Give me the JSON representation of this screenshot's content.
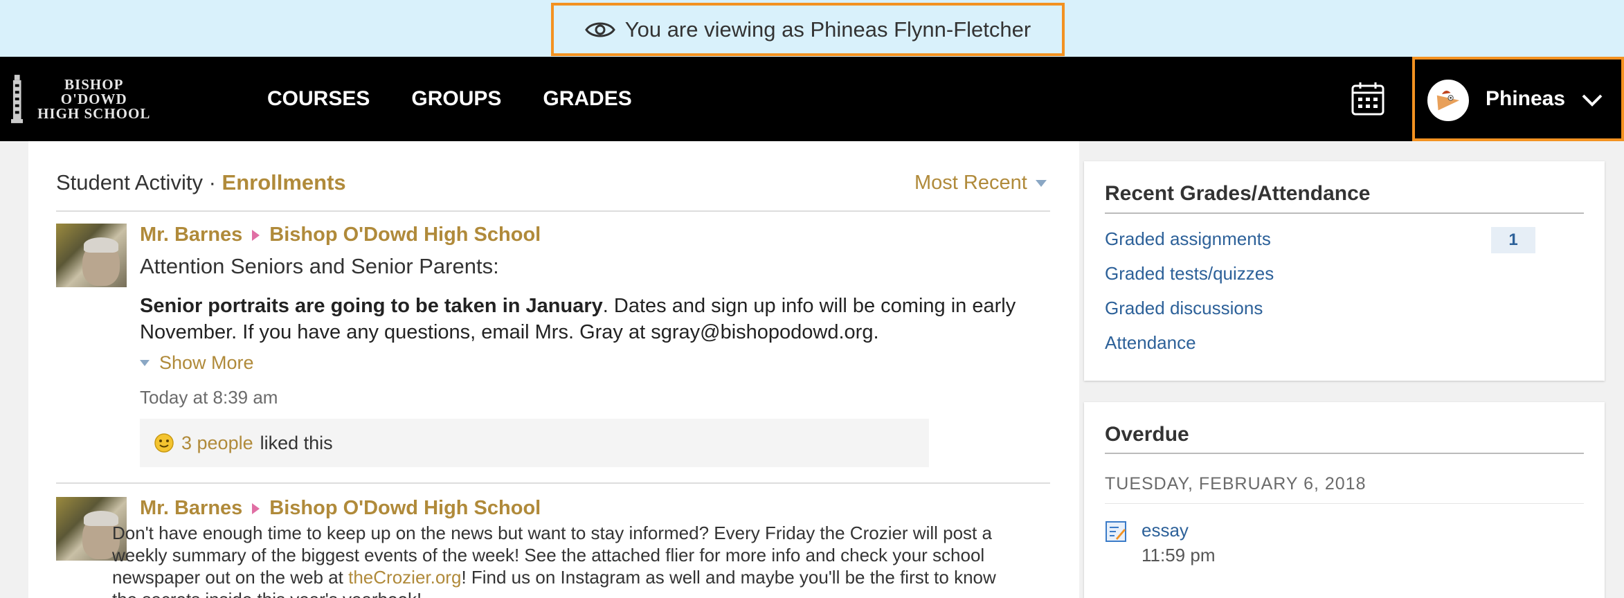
{
  "masquerade": {
    "text": "You are viewing as Phineas Flynn-Fletcher"
  },
  "header": {
    "logo_line1": "BISHOP O'DOWD",
    "logo_line2": "HIGH SCHOOL",
    "nav": [
      "COURSES",
      "GROUPS",
      "GRADES"
    ],
    "user_name": "Phineas",
    "accent_color": "#f39221"
  },
  "activity": {
    "title": "Student Activity",
    "separator": "·",
    "tab_link": "Enrollments",
    "sort_label": "Most Recent",
    "posts": [
      {
        "author": "Mr. Barnes",
        "target": "Bishop O'Dowd High School",
        "lead": "Attention Seniors and Senior Parents:",
        "bold_text": "Senior portraits are going to be taken in January",
        "body_rest": ". Dates and sign up info will be coming in early November. If you have any questions, email Mrs. Gray at sgray@bishopodowd.org.",
        "show_more": "Show More",
        "timestamp": "Today at 8:39 am",
        "likes_count": "3 people",
        "likes_suffix": "liked this"
      },
      {
        "author": "Mr. Barnes",
        "target": "Bishop O'Dowd High School",
        "body_part1": "Don't have enough time to keep up on the news but want to stay informed? Every Friday the Crozier will post a weekly summary of the biggest events of the week! See the attached flier for more info and check your school newspaper out on the web at ",
        "link": "theCrozier.org",
        "body_part2": "! Find us on Instagram as well and maybe you'll be the first to know the secrets inside this year's yearbook!"
      }
    ]
  },
  "recent_grades": {
    "title": "Recent Grades/Attendance",
    "links": [
      "Graded assignments",
      "Graded tests/quizzes",
      "Graded discussions",
      "Attendance"
    ],
    "badge": "1"
  },
  "overdue": {
    "title": "Overdue",
    "date": "TUESDAY, FEBRUARY 6, 2018",
    "item_name": "essay",
    "item_time": "11:59 pm"
  }
}
